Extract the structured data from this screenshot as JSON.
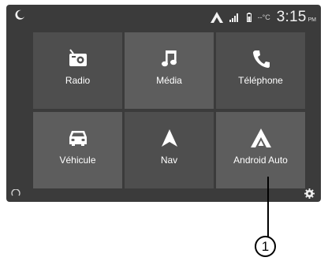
{
  "status": {
    "temperature": "--°C",
    "time": "3:15",
    "ampm": "PM",
    "icons": [
      "moon-icon",
      "android-auto-status-icon",
      "signal-icon",
      "battery-icon"
    ]
  },
  "tiles": [
    {
      "label": "Radio",
      "icon": "radio-icon"
    },
    {
      "label": "Média",
      "icon": "music-note-icon"
    },
    {
      "label": "Téléphone",
      "icon": "phone-icon"
    },
    {
      "label": "Véhicule",
      "icon": "car-icon"
    },
    {
      "label": "Nav",
      "icon": "navigation-arrow-icon"
    },
    {
      "label": "Android Auto",
      "icon": "android-auto-icon"
    }
  ],
  "bottom_icons": [
    "voice-assistant-icon",
    "gear-icon"
  ],
  "callout": {
    "number": "1"
  },
  "colors": {
    "screen_bg": "#3b3b3b",
    "tile_bg": "#4e4e4e",
    "tile_bg_light": "#5d5d5d",
    "text": "#ffffff"
  }
}
